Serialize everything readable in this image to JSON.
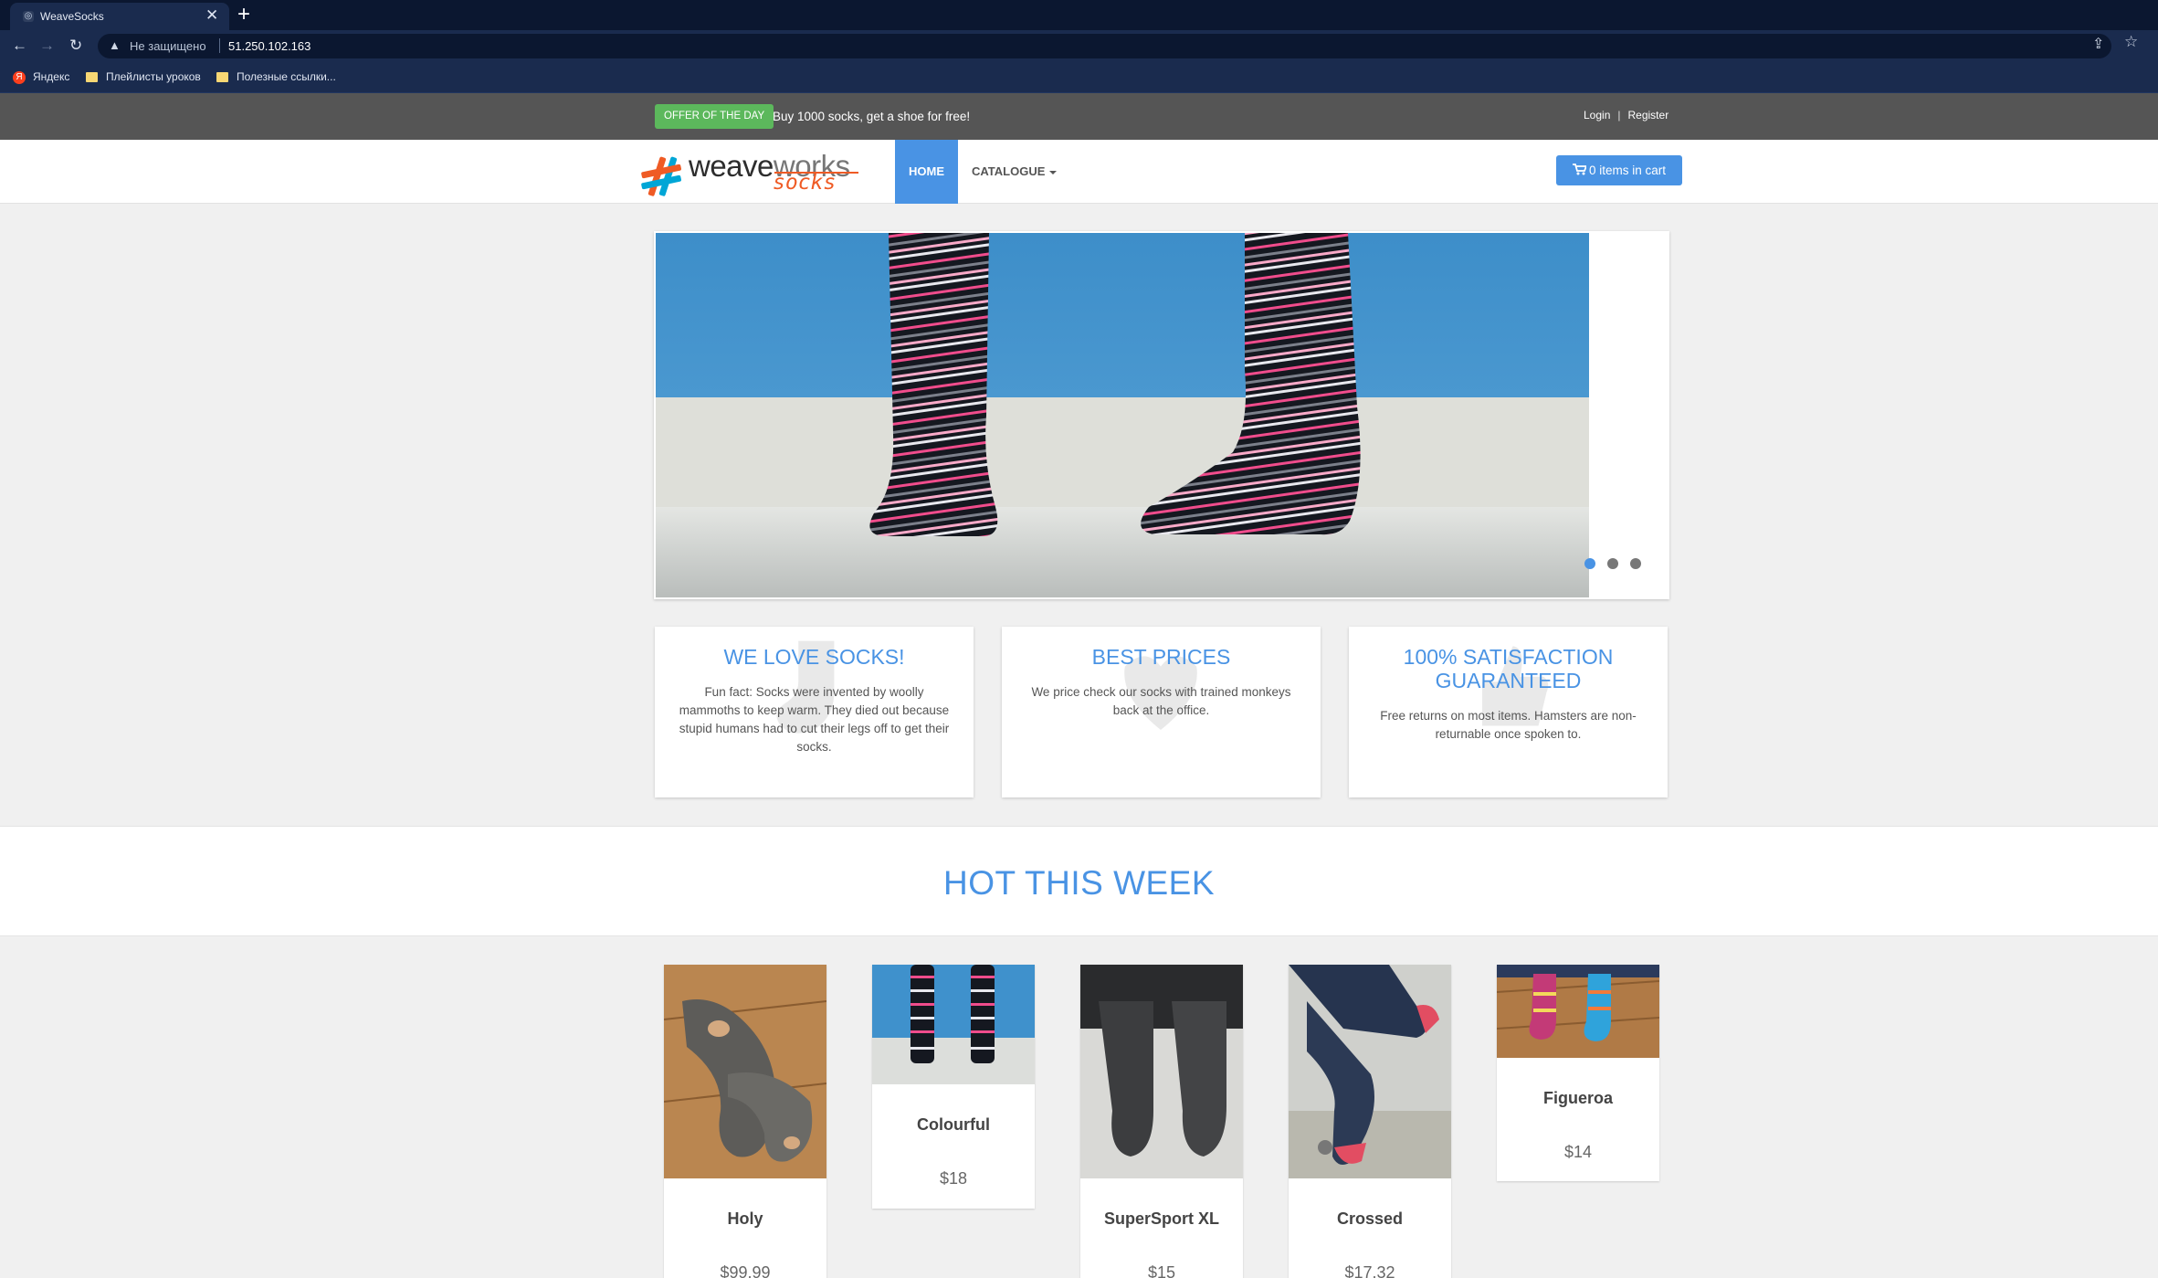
{
  "browser": {
    "tab_title": "WeaveSocks",
    "tab_close": "✕",
    "new_tab": "+",
    "not_secure": "Не защищено",
    "url": "51.250.102.163",
    "bookmarks": [
      {
        "label": "Яндекс",
        "icon": "yandex-icon"
      },
      {
        "label": "Плейлисты уроков",
        "icon": "folder-icon"
      },
      {
        "label": "Полезные ссылки...",
        "icon": "folder-icon"
      }
    ]
  },
  "topbar": {
    "offer_badge": "OFFER OF THE DAY",
    "offer_text": "Buy 1000 socks, get a shoe for free!",
    "login": "Login",
    "separator": "|",
    "register": "Register"
  },
  "navbar": {
    "logo_main": "weave",
    "logo_works": "works",
    "logo_sub": "socks",
    "home": "HOME",
    "catalogue": "CATALOGUE",
    "cart": "0 items in cart",
    "accent_color": "#4993e4"
  },
  "carousel": {
    "slides": 3,
    "active_slide": 1,
    "active_dot_color": "#4993e4",
    "dot_color": "#777777"
  },
  "features": [
    {
      "title": "WE LOVE SOCKS!",
      "text": "Fun fact: Socks were invented by woolly mammoths to keep warm. They died out because stupid humans had to cut their legs off to get their socks."
    },
    {
      "title": "BEST PRICES",
      "text": "We price check our socks with trained monkeys back at the office."
    },
    {
      "title": "100% SATISFACTION GUARANTEED",
      "text": "Free returns on most items. Hamsters are non-returnable once spoken to."
    }
  ],
  "hot": {
    "title": "HOT THIS WEEK",
    "products": [
      {
        "name": "Holy",
        "price": "$99.99"
      },
      {
        "name": "Colourful",
        "price": "$18"
      },
      {
        "name": "SuperSport XL",
        "price": "$15"
      },
      {
        "name": "Crossed",
        "price": "$17.32"
      },
      {
        "name": "Figueroa",
        "price": "$14"
      }
    ]
  }
}
